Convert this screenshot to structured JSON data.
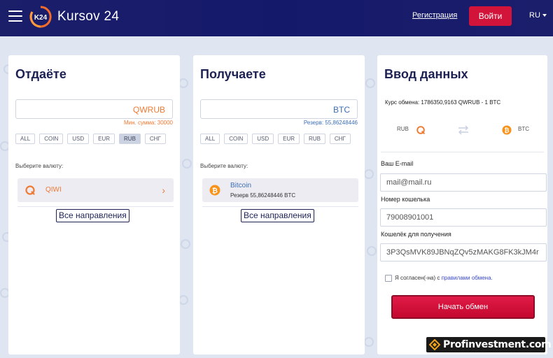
{
  "header": {
    "logo_text": "Kursov 24",
    "logo_badge": "K24",
    "register_label": "Регистрация",
    "login_label": "Войти",
    "language": "RU"
  },
  "give": {
    "title": "Отдаёте",
    "currency_code": "QWRUB",
    "hint": "Мин. сумма: 30000",
    "filters": [
      "ALL",
      "COIN",
      "USD",
      "EUR",
      "RUB",
      "СНГ"
    ],
    "active_filter": "RUB",
    "choose_label": "Выберите валюту:",
    "selected_currency": "QIWI",
    "all_directions_label": "Все направления"
  },
  "get": {
    "title": "Получаете",
    "currency_code": "BTC",
    "hint": "Резерв: 55,86248446",
    "filters": [
      "ALL",
      "COIN",
      "USD",
      "EUR",
      "RUB",
      "СНГ"
    ],
    "choose_label": "Выберите валюту:",
    "selected_currency": "Bitcoin",
    "reserve_text": "Резерв 55,86248446 BTC",
    "all_directions_label": "Все направления"
  },
  "data": {
    "title": "Ввод данных",
    "rate_text": "Курс обмена: 1786350,9163 QWRUB - 1 BTC",
    "from_label": "RUB",
    "to_label": "BTC",
    "email_label": "Ваш E-mail",
    "email_placeholder": "mail@mail.ru",
    "wallet_label": "Номер кошелька",
    "wallet_placeholder": "79008901001",
    "receive_label": "Кошелёк для получения",
    "receive_placeholder": "3P3QsMVK89JBNqZQv5zMAKG8FK3kJM4r",
    "agree_text": "Я согласен(-на) с",
    "agree_link": "правилами обмена.",
    "start_label": "Начать обмен"
  },
  "watermark": {
    "text": "Profinvestment.com"
  },
  "colors": {
    "header_bg": "#1b1f6a",
    "accent_red": "#d2133a",
    "qiwi_orange": "#ef7a34",
    "btc_orange": "#f7931a",
    "link_blue": "#3d6fb8"
  },
  "icons": {
    "menu": "hamburger-icon",
    "qiwi": "qiwi-icon",
    "bitcoin": "bitcoin-icon",
    "swap": "swap-arrows-icon",
    "chevron": "chevron-right-icon"
  }
}
